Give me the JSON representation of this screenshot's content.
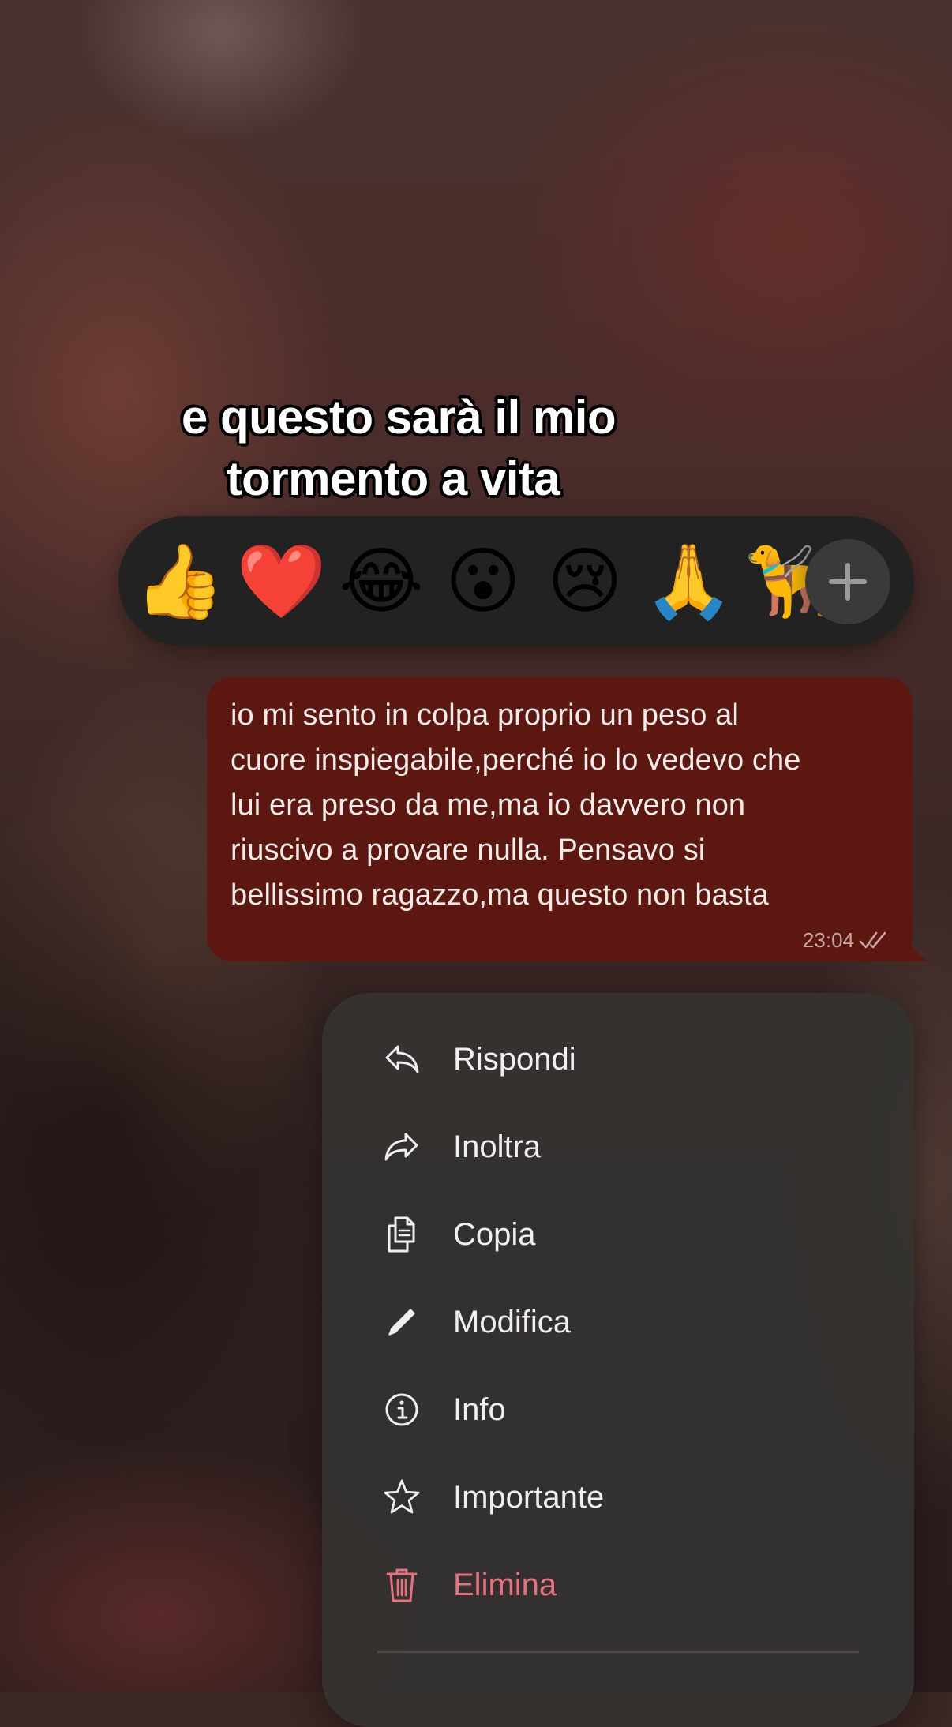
{
  "caption": {
    "line1": "e questo sarà il mio",
    "line2": "tormento a vita"
  },
  "reactions": {
    "emojis": [
      "👍",
      "❤️",
      "😂",
      "😮",
      "😢",
      "🙏",
      "🦮"
    ],
    "add_icon": "plus-icon"
  },
  "message": {
    "text": "io mi sento in colpa proprio un peso al\ncuore inspiegabile,perché io lo vedevo che\nlui era preso da me,ma io davvero non\nriuscivo a provare nulla. Pensavo si\nbellissimo ragazzo,ma questo non basta",
    "time": "23:04",
    "status_icon": "double-check-icon",
    "bubble_color": "#5c1710"
  },
  "menu": {
    "items": [
      {
        "label": "Rispondi",
        "icon": "reply-icon"
      },
      {
        "label": "Inoltra",
        "icon": "forward-icon"
      },
      {
        "label": "Copia",
        "icon": "copy-icon"
      },
      {
        "label": "Modifica",
        "icon": "pencil-icon"
      },
      {
        "label": "Info",
        "icon": "info-icon"
      },
      {
        "label": "Importante",
        "icon": "star-icon"
      },
      {
        "label": "Elimina",
        "icon": "trash-icon"
      }
    ],
    "danger_color": "#e8707f"
  }
}
